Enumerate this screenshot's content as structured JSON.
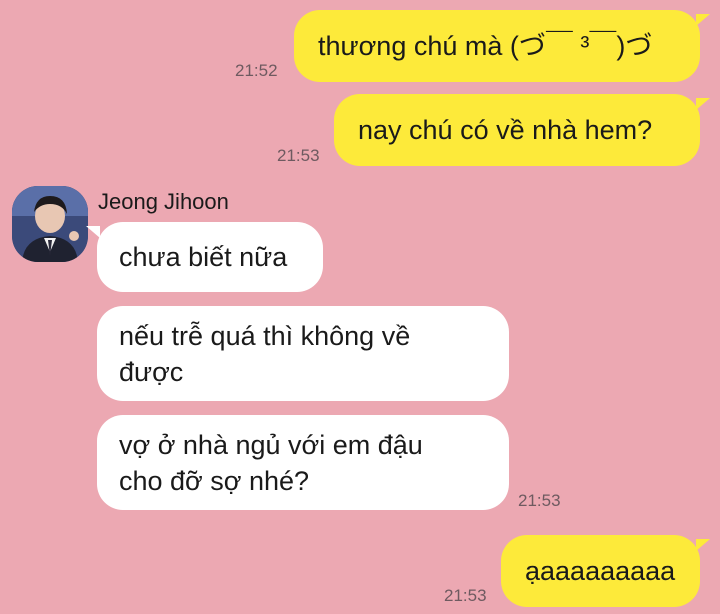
{
  "conversation": {
    "contact": {
      "name": "Jeong Jihoon",
      "avatar": "avatar-photo"
    },
    "messages": [
      {
        "sender": "me",
        "text": "thương chú mà (づ￣ ³￣)づ",
        "time": "21:52"
      },
      {
        "sender": "me",
        "text": "nay chú có về nhà hem?",
        "time": "21:53"
      },
      {
        "sender": "contact",
        "text": "chưa biết nữa"
      },
      {
        "sender": "contact",
        "text": "nếu trễ quá thì không về\nđược"
      },
      {
        "sender": "contact",
        "text": "vợ ở nhà ngủ với em đậu\ncho đỡ sợ nhé?",
        "time": "21:53"
      },
      {
        "sender": "me",
        "text": "ạaaaaaaaaa",
        "time": "21:53"
      }
    ]
  },
  "colors": {
    "background": "#eca8b2",
    "my_bubble": "#fdea3a",
    "their_bubble": "#ffffff"
  }
}
